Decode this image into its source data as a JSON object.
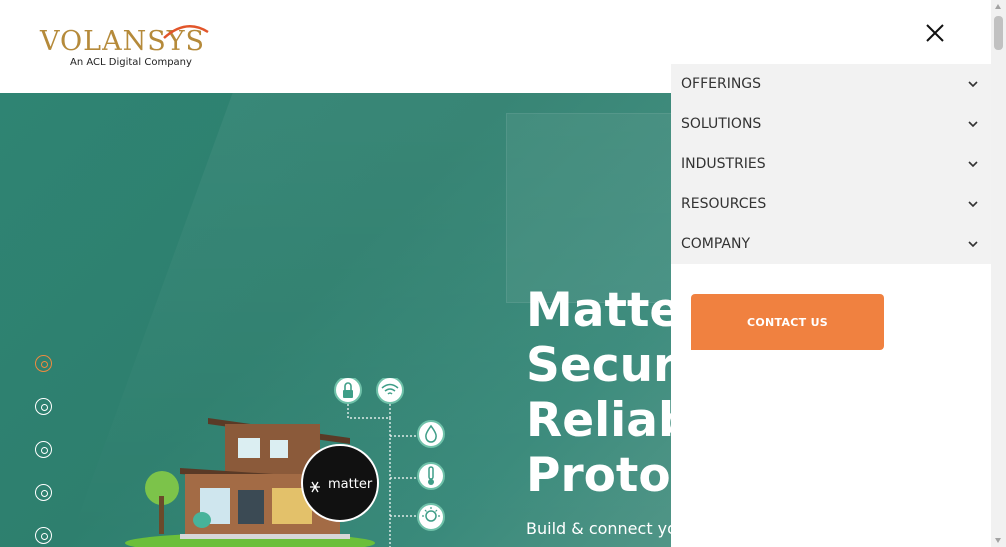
{
  "brand": {
    "name": "VOLANSYS",
    "tagline": "An ACL Digital Company",
    "primary_color": "#b58a3a",
    "accent_color": "#f08140"
  },
  "hero": {
    "title_lines": [
      "Matte",
      "Secur",
      "Reliab",
      "Protoc"
    ],
    "subtitle": "Build & connect yo",
    "illustration_badge": "matter",
    "slider_dots": 5,
    "active_dot": 0,
    "background_color": "#2f8473"
  },
  "drawer": {
    "close_icon": "close-icon",
    "menu": [
      {
        "label": "OFFERINGS"
      },
      {
        "label": "SOLUTIONS"
      },
      {
        "label": "INDUSTRIES"
      },
      {
        "label": "RESOURCES"
      },
      {
        "label": "COMPANY"
      }
    ],
    "contact_label": "CONTACT US"
  }
}
